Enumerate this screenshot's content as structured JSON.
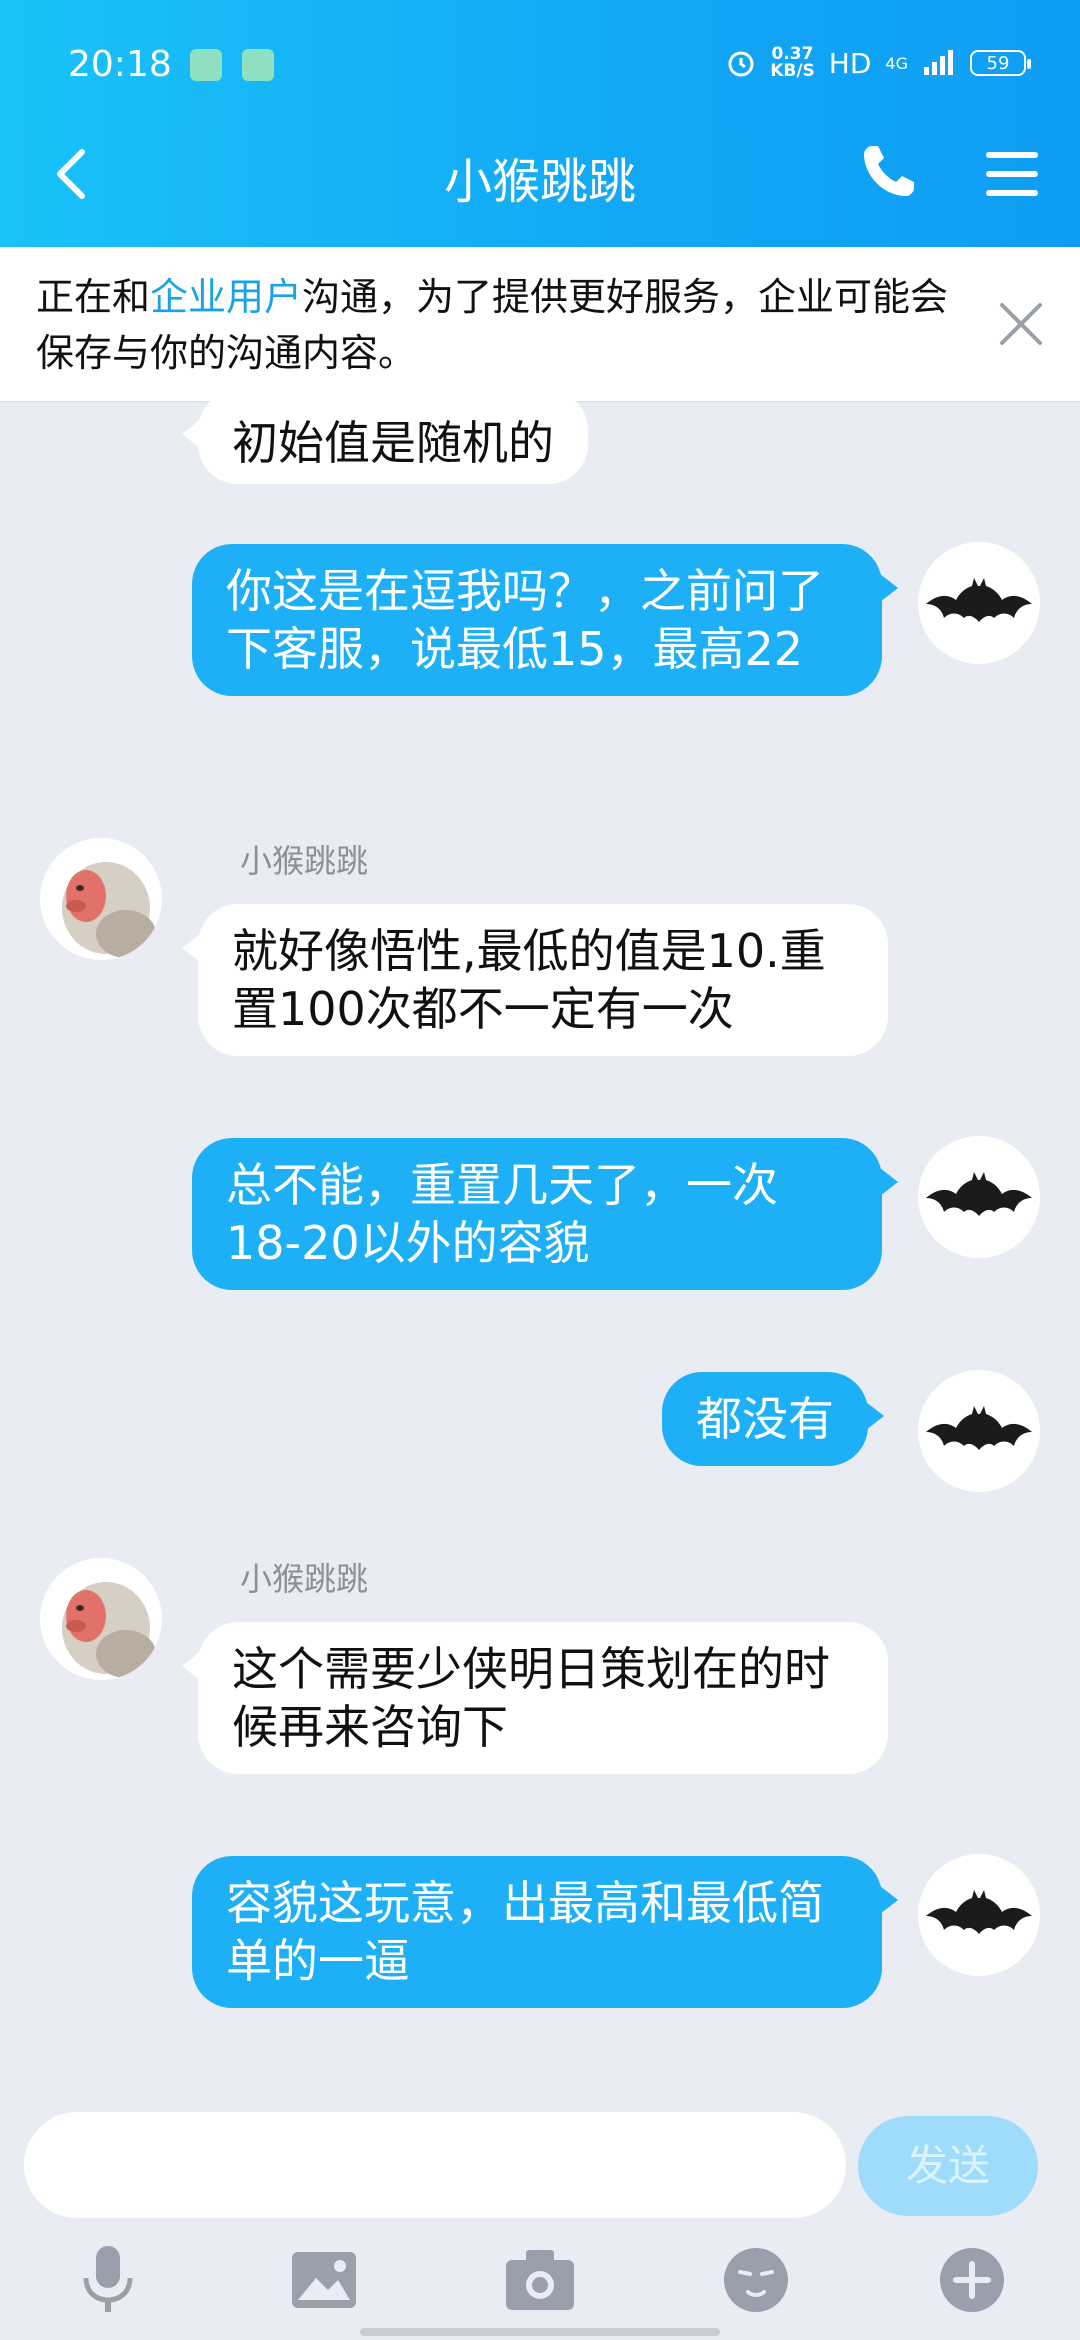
{
  "status_bar": {
    "time": "20:18",
    "speed_value": "0.37",
    "speed_unit": "KB/S",
    "hd": "HD",
    "network": "4G",
    "battery": "59"
  },
  "header": {
    "title": "小猴跳跳"
  },
  "notice": {
    "prefix": "正在和",
    "highlight": "企业用户",
    "suffix": "沟通，为了提供更好服务，企业可能会保存与你的沟通内容。"
  },
  "messages": [
    {
      "from": "contact",
      "sender": "",
      "text": "初始值是随机的"
    },
    {
      "from": "me",
      "text": "你这是在逗我吗？，之前问了下客服，说最低15，最高22"
    },
    {
      "from": "contact",
      "sender": "小猴跳跳",
      "text": "就好像悟性,最低的值是10.重置100次都不一定有一次"
    },
    {
      "from": "me",
      "text": "总不能，重置几天了，一次18-20以外的容貌"
    },
    {
      "from": "me",
      "text": "都没有"
    },
    {
      "from": "contact",
      "sender": "小猴跳跳",
      "text": "这个需要少侠明日策划在的时候再来咨询下"
    },
    {
      "from": "me",
      "text": "容貌这玩意，出最高和最低简单的一逼"
    }
  ],
  "input": {
    "placeholder": "",
    "send_label": "发送"
  },
  "toolbar": {
    "icons": [
      "microphone-icon",
      "image-icon",
      "camera-icon",
      "emoji-icon",
      "plus-icon"
    ]
  },
  "colors": {
    "header_gradient_start": "#19c2f8",
    "header_gradient_end": "#0f9df3",
    "outgoing_bubble": "#1eb0f6",
    "incoming_bubble": "#ffffff",
    "chat_background": "#e9ecf2",
    "notice_highlight": "#1aa2e8"
  }
}
